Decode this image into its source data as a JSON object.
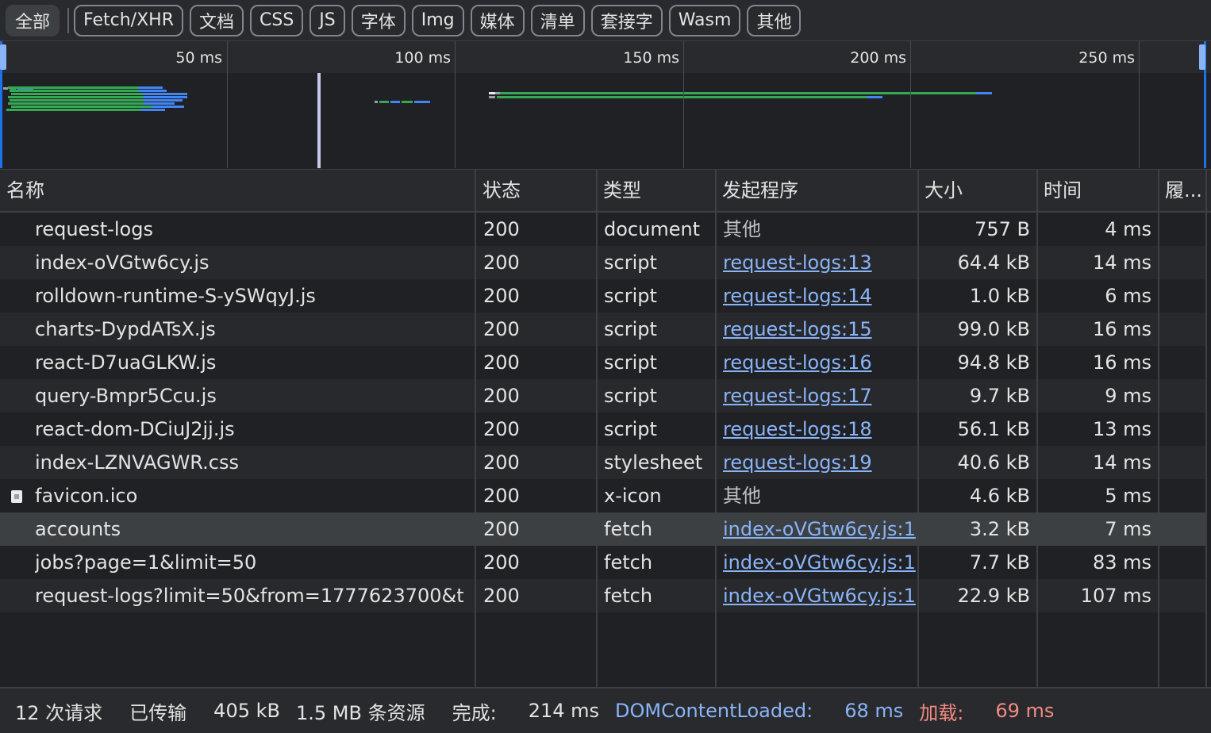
{
  "filters": [
    {
      "label": "全部",
      "active": true
    },
    {
      "label": "Fetch/XHR"
    },
    {
      "label": "文档"
    },
    {
      "label": "CSS"
    },
    {
      "label": "JS"
    },
    {
      "label": "字体"
    },
    {
      "label": "Img"
    },
    {
      "label": "媒体"
    },
    {
      "label": "清单"
    },
    {
      "label": "套接字"
    },
    {
      "label": "Wasm"
    },
    {
      "label": "其他"
    }
  ],
  "overview": {
    "ticks": [
      "50 ms",
      "100 ms",
      "150 ms",
      "200 ms",
      "250 ms"
    ],
    "colors": {
      "waiting": "#34a853",
      "download": "#4285f4",
      "queue": "#9aa0a6",
      "blocked": "#e8eaed"
    }
  },
  "columns": {
    "name": "名称",
    "status": "状态",
    "type": "类型",
    "initiator": "发起程序",
    "size": "大小",
    "time": "时间",
    "waterfall": "履..."
  },
  "rows": [
    {
      "name": "request-logs",
      "status": "200",
      "type": "document",
      "initiator": "其他",
      "initiator_link": false,
      "size": "757 B",
      "time": "4 ms"
    },
    {
      "name": "index-oVGtw6cy.js",
      "status": "200",
      "type": "script",
      "initiator": "request-logs:13",
      "initiator_link": true,
      "size": "64.4 kB",
      "time": "14 ms"
    },
    {
      "name": "rolldown-runtime-S-ySWqyJ.js",
      "status": "200",
      "type": "script",
      "initiator": "request-logs:14",
      "initiator_link": true,
      "size": "1.0 kB",
      "time": "6 ms"
    },
    {
      "name": "charts-DypdATsX.js",
      "status": "200",
      "type": "script",
      "initiator": "request-logs:15",
      "initiator_link": true,
      "size": "99.0 kB",
      "time": "16 ms"
    },
    {
      "name": "react-D7uaGLKW.js",
      "status": "200",
      "type": "script",
      "initiator": "request-logs:16",
      "initiator_link": true,
      "size": "94.8 kB",
      "time": "16 ms"
    },
    {
      "name": "query-Bmpr5Ccu.js",
      "status": "200",
      "type": "script",
      "initiator": "request-logs:17",
      "initiator_link": true,
      "size": "9.7 kB",
      "time": "9 ms"
    },
    {
      "name": "react-dom-DCiuJ2jj.js",
      "status": "200",
      "type": "script",
      "initiator": "request-logs:18",
      "initiator_link": true,
      "size": "56.1 kB",
      "time": "13 ms"
    },
    {
      "name": "index-LZNVAGWR.css",
      "status": "200",
      "type": "stylesheet",
      "initiator": "request-logs:19",
      "initiator_link": true,
      "size": "40.6 kB",
      "time": "14 ms"
    },
    {
      "name": "favicon.ico",
      "status": "200",
      "type": "x-icon",
      "initiator": "其他",
      "initiator_link": false,
      "size": "4.6 kB",
      "time": "5 ms",
      "icon": "file-icon"
    },
    {
      "name": "accounts",
      "status": "200",
      "type": "fetch",
      "initiator": "index-oVGtw6cy.js:1",
      "initiator_link": true,
      "size": "3.2 kB",
      "time": "7 ms",
      "selected": true
    },
    {
      "name": "jobs?page=1&limit=50",
      "status": "200",
      "type": "fetch",
      "initiator": "index-oVGtw6cy.js:1",
      "initiator_link": true,
      "size": "7.7 kB",
      "time": "83 ms"
    },
    {
      "name": "request-logs?limit=50&from=1777623700&t...",
      "status": "200",
      "type": "fetch",
      "initiator": "index-oVGtw6cy.js:1",
      "initiator_link": true,
      "size": "22.9 kB",
      "time": "107 ms"
    }
  ],
  "status_bar": {
    "requests": "12 次请求",
    "transferred": "已传输",
    "transferred_size": "405 kB",
    "resources": "1.5 MB 条资源",
    "finish_label": "完成:",
    "finish_value": "214 ms",
    "dcl_label": "DOMContentLoaded:",
    "dcl_value": "68 ms",
    "load_label": "加载:",
    "load_value": "69 ms"
  }
}
